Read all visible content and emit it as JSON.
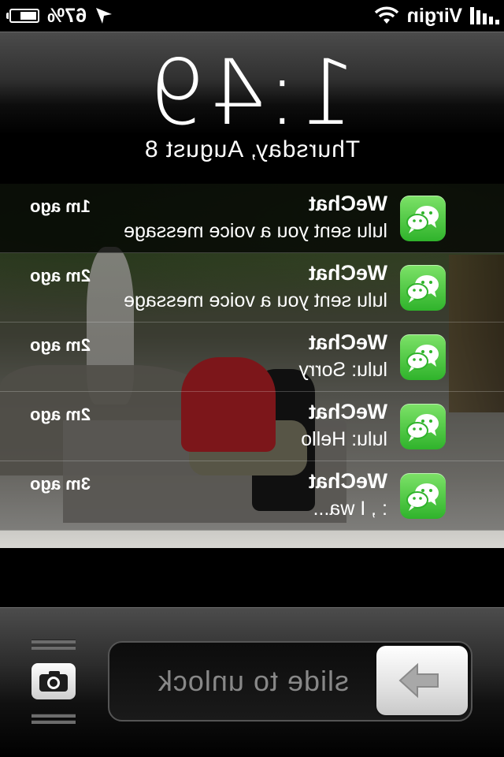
{
  "status_bar": {
    "carrier": "Virgin",
    "battery_percent": "67%",
    "battery_level": 0.67,
    "signal_icon": "signal-bars-icon",
    "wifi_icon": "wifi-icon",
    "location_icon": "location-arrow-icon"
  },
  "lock_clock": {
    "time": "1:49",
    "date": "Thursday, August 8"
  },
  "notifications": [
    {
      "app": "WeChat",
      "message": "lulu sent you a voice message",
      "age": "1m ago",
      "icon": "wechat-icon"
    },
    {
      "app": "WeChat",
      "message": "lulu sent you a voice message",
      "age": "2m ago",
      "icon": "wechat-icon"
    },
    {
      "app": "WeChat",
      "message": "lulu: Sorry",
      "age": "2m ago",
      "icon": "wechat-icon"
    },
    {
      "app": "WeChat",
      "message": "lulu: Hello",
      "age": "2m ago",
      "icon": "wechat-icon"
    },
    {
      "app": "WeChat",
      "message": ": , I wa...",
      "age": "3m ago",
      "icon": "wechat-icon"
    }
  ],
  "unlock": {
    "label": "slide to unlock",
    "arrow_icon": "arrow-right-icon",
    "camera_icon": "camera-icon"
  },
  "colors": {
    "wechat_green": "#2fb32b",
    "background": "#000000"
  }
}
